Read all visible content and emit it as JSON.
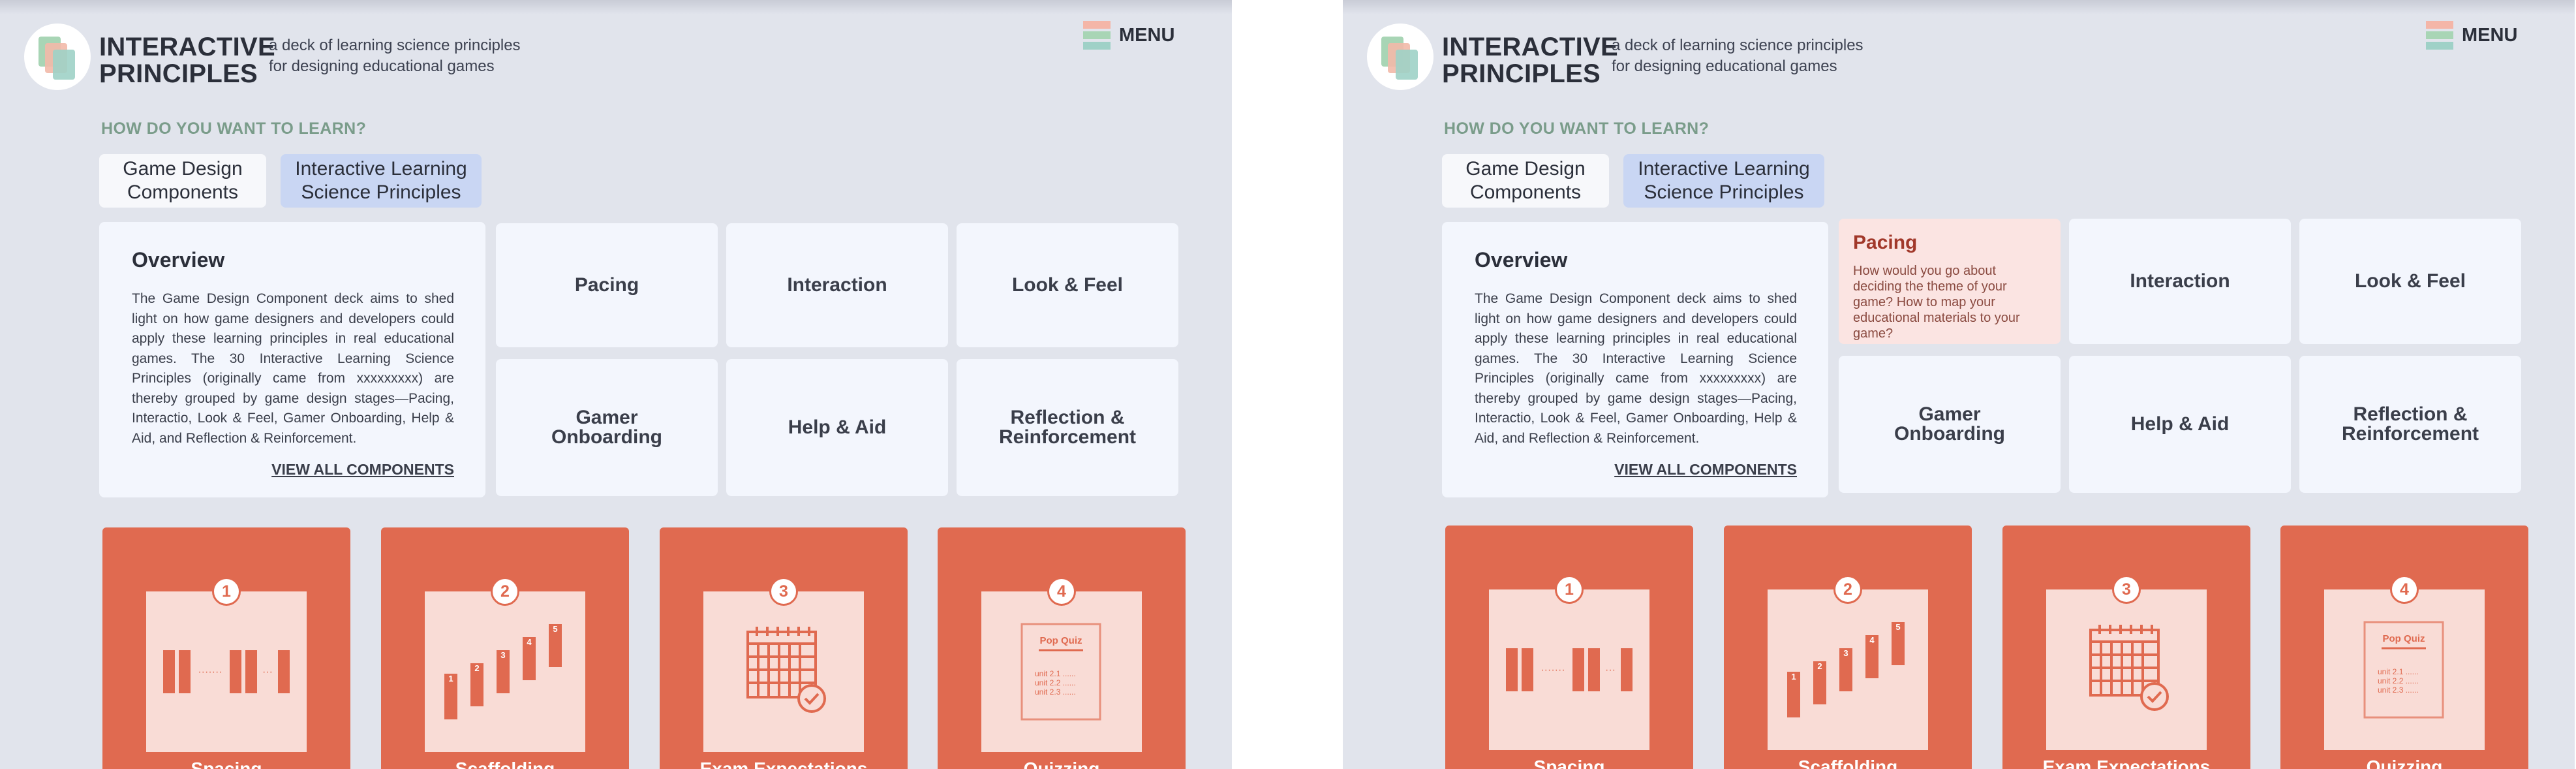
{
  "brand": {
    "line1": "INTERACTIVE",
    "line2": "PRINCIPLES",
    "tagline_line1": "a deck of learning science principles",
    "tagline_line2": "for designing educational games"
  },
  "menu": {
    "label": "MENU"
  },
  "prompt": "HOW DO YOU WANT TO LEARN?",
  "tabs": [
    {
      "line1": "Game Design",
      "line2": "Components"
    },
    {
      "line1": "Interactive Learning",
      "line2": "Science Principles"
    }
  ],
  "overview": {
    "title": "Overview",
    "text": "The Game Design Component deck aims to shed light on how game designers and developers could apply these learning principles in real educational games. The 30 Interactive Learning Science Principles (originally came from xxxxxxxxx) are thereby grouped by game design stages—Pacing, Interactio, Look & Feel, Gamer Onboarding, Help & Aid, and Reflection & Reinforcement.",
    "link": "VIEW ALL COMPONENTS"
  },
  "categories": [
    {
      "line1": "Pacing",
      "line2": ""
    },
    {
      "line1": "Interaction",
      "line2": ""
    },
    {
      "line1": "Look & Feel",
      "line2": ""
    },
    {
      "line1": "Gamer",
      "line2": "Onboarding"
    },
    {
      "line1": "Help & Aid",
      "line2": ""
    },
    {
      "line1": "Reflection &",
      "line2": "Reinforcement"
    }
  ],
  "pacing_hover": {
    "title": "Pacing",
    "description": "How would you go about deciding the theme of your game? How to map your educational materials to your game?"
  },
  "strategy_cards": [
    {
      "number": "1",
      "label": "Spacing"
    },
    {
      "number": "2",
      "label": "Scaffolding"
    },
    {
      "number": "3",
      "label": "Exam Expectations"
    },
    {
      "number": "4",
      "label": "Quizzing"
    }
  ],
  "card_art": {
    "dots_long": "·······",
    "dots_short": "···",
    "steps": [
      "1",
      "2",
      "3",
      "4",
      "5"
    ],
    "quiz_title": "Pop Quiz",
    "quiz_lines": [
      "unit 2.1  ......",
      "unit 2.2  ......",
      "unit 2.3  ......"
    ]
  },
  "colors": {
    "background": "#e1e4ec",
    "tab_active": "#c9d6f3",
    "card_red": "#e06a50",
    "prompt_green": "#7a9c8a",
    "hover_pink": "#fbe4e2"
  }
}
